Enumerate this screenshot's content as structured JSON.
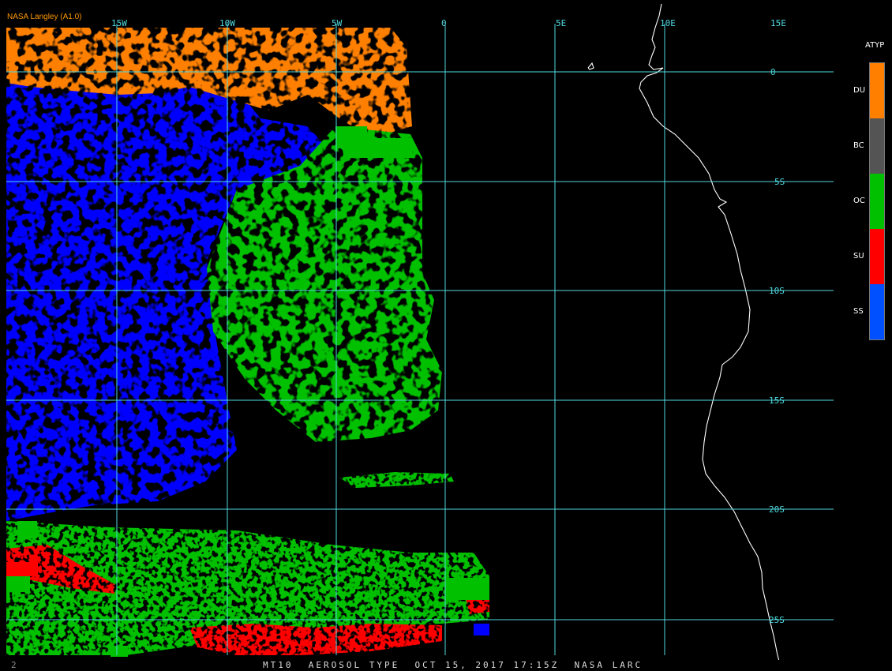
{
  "credit": "NASA Langley (A1.0)",
  "footer": {
    "mark": "2",
    "text": "MT10  AEROSOL TYPE  OCT 15, 2017 17:15Z  NASA LARC"
  },
  "grid": {
    "lon_labels": [
      "15W",
      "10W",
      "5W",
      "0",
      "5E",
      "10E",
      "15E"
    ],
    "lat_labels": [
      "0",
      "5S",
      "10S",
      "15S",
      "20S",
      "25S"
    ],
    "line_color": "#4fd9e0"
  },
  "legend": {
    "title": "ATYP",
    "items": [
      {
        "code": "DU",
        "color": "#ff8000"
      },
      {
        "code": "BC",
        "color": "#545454"
      },
      {
        "code": "OC",
        "color": "#00c000"
      },
      {
        "code": "SU",
        "color": "#ff0000"
      },
      {
        "code": "SS",
        "color": "#0050ff"
      }
    ]
  },
  "colors": {
    "dust": "#ff8000",
    "organic_carbon": "#00c000",
    "sulfate": "#ff0000",
    "sea_salt_blue": "#0000ff",
    "coastline": "#ffffff"
  }
}
